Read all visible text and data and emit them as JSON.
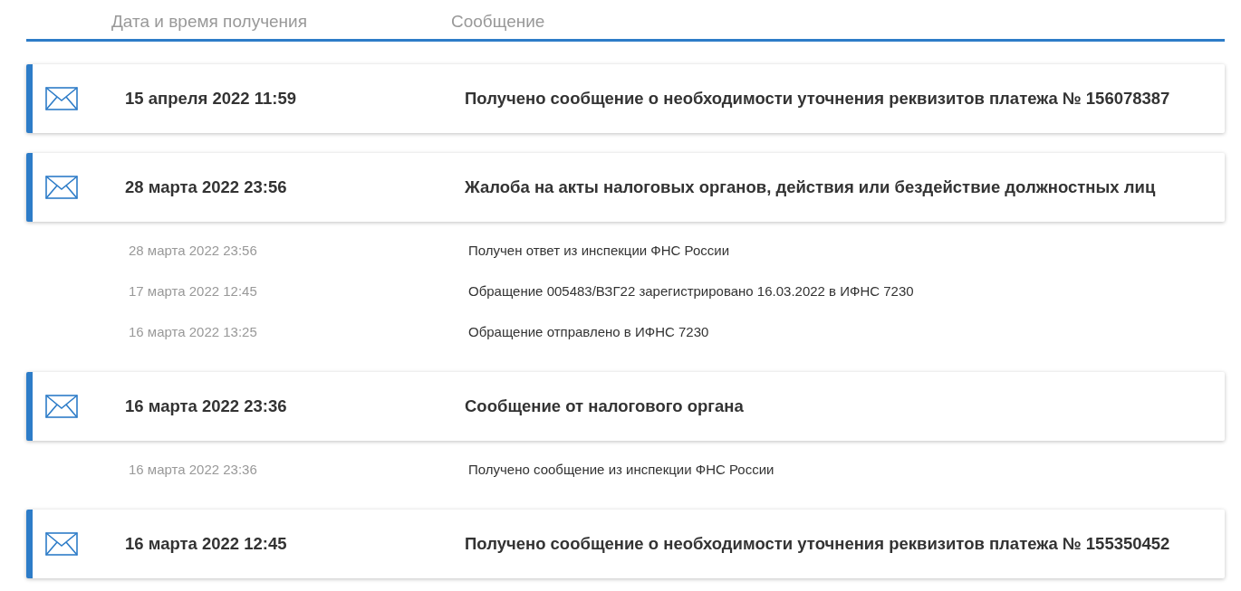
{
  "columns": [
    "Дата и время получения",
    "Сообщение"
  ],
  "messages": [
    {
      "date": "15 апреля 2022 11:59",
      "text": "Получено сообщение о необходимости уточнения реквизитов платежа № 156078387"
    },
    {
      "date": "28 марта 2022 23:56",
      "text": "Жалоба на акты налоговых органов, действия или бездействие должностных лиц",
      "events": [
        {
          "date": "28 марта 2022 23:56",
          "text": "Получен ответ из инспекции ФНС России"
        },
        {
          "date": "17 марта 2022 12:45",
          "text": "Обращение 005483/ВЗГ22 зарегистрировано 16.03.2022 в ИФНС 7230"
        },
        {
          "date": "16 марта 2022 13:25",
          "text": "Обращение отправлено в ИФНС 7230"
        }
      ]
    },
    {
      "date": "16 марта 2022 23:36",
      "text": "Сообщение от налогового органа",
      "events": [
        {
          "date": "16 марта 2022 23:36",
          "text": "Получено сообщение из инспекции ФНС России"
        }
      ]
    },
    {
      "date": "16 марта 2022 12:45",
      "text": "Получено сообщение о необходимости уточнения реквизитов платежа № 155350452"
    }
  ]
}
